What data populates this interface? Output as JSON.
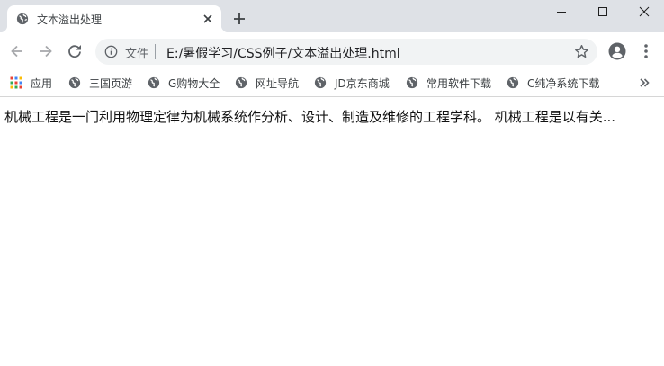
{
  "tab": {
    "title": "文本溢出处理",
    "favicon": "globe-icon",
    "close_icon": "close-icon"
  },
  "newtab": {
    "icon": "plus-icon"
  },
  "window_controls": {
    "minimize": "minimize-icon",
    "maximize": "maximize-icon",
    "close": "close-icon"
  },
  "toolbar": {
    "back_icon": "arrow-left-icon",
    "forward_icon": "arrow-right-icon",
    "reload_icon": "reload-icon",
    "info_icon": "info-icon",
    "chip_label": "文件",
    "url": "E:/暑假学习/CSS例子/文本溢出处理.html",
    "star_icon": "star-icon",
    "profile_icon": "account-icon",
    "menu_icon": "more-vert-icon"
  },
  "bookmarks": {
    "items": [
      {
        "label": "应用",
        "icon": "apps-grid-icon"
      },
      {
        "label": "三国页游",
        "icon": "globe-icon"
      },
      {
        "label": "G购物大全",
        "icon": "globe-icon"
      },
      {
        "label": "网址导航",
        "icon": "globe-icon"
      },
      {
        "label": "JD京东商城",
        "icon": "globe-icon"
      },
      {
        "label": "常用软件下载",
        "icon": "globe-icon"
      },
      {
        "label": "C纯净系统下载",
        "icon": "globe-icon"
      }
    ],
    "overflow_icon": "chevron-double-right-icon"
  },
  "page": {
    "paragraph": "机械工程是一门利用物理定律为机械系统作分析、设计、制造及维修的工程学科。 机械工程是以有关..."
  },
  "colors": {
    "tabstrip": "#dee1e6",
    "omnibox": "#f1f3f4",
    "text": "#3c4043",
    "icon": "#5f6368"
  }
}
